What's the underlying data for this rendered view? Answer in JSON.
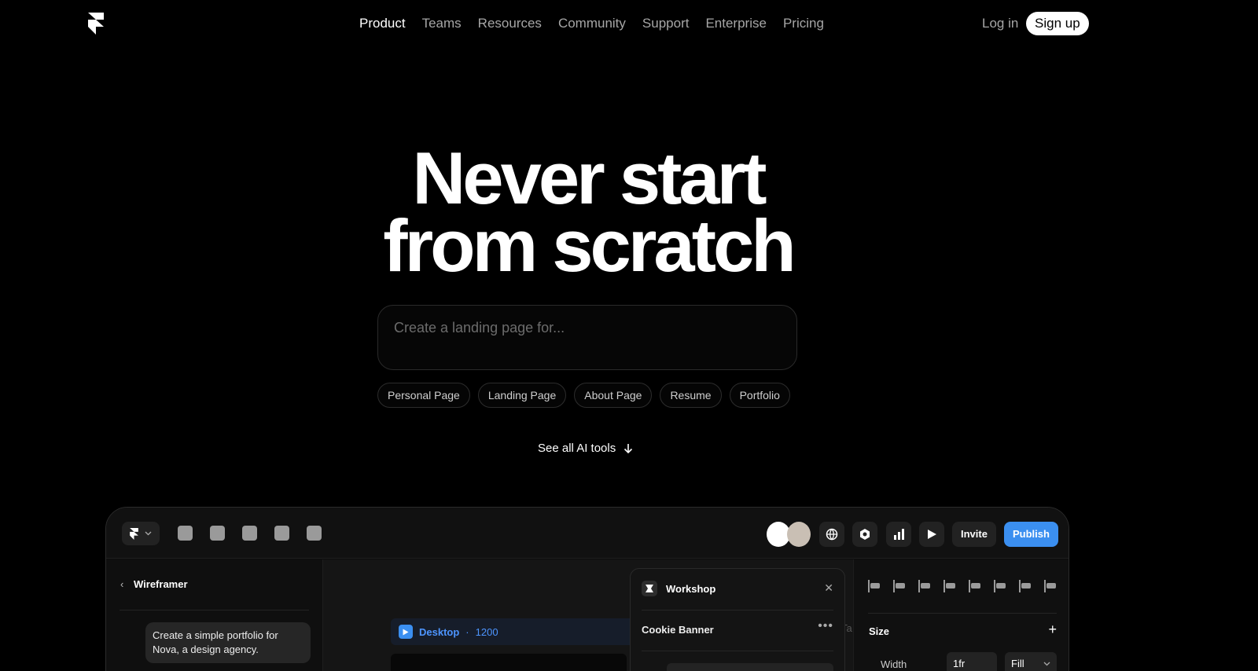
{
  "nav": {
    "links": [
      "Product",
      "Teams",
      "Resources",
      "Community",
      "Support",
      "Enterprise",
      "Pricing"
    ],
    "active": "Product",
    "login": "Log in",
    "signup": "Sign up"
  },
  "hero": {
    "title_line1": "Never start",
    "title_line2": "from scratch",
    "prompt_placeholder": "Create a landing page for...",
    "chips": [
      "Personal Page",
      "Landing Page",
      "About Page",
      "Resume",
      "Portfolio"
    ],
    "see_all": "See all AI tools"
  },
  "app": {
    "toolbar": {
      "tools": [
        "insert-icon",
        "layout-icon",
        "text-icon",
        "vector-icon",
        "cms-icon"
      ],
      "invite": "Invite",
      "publish": "Publish",
      "right_icons": [
        "globe-icon",
        "settings-icon",
        "analytics-icon",
        "preview-icon"
      ]
    },
    "left_panel": {
      "title": "Wireframer",
      "message": "Create a simple portfolio for Nova, a design agency."
    },
    "canvas": {
      "breakpoint": "Desktop",
      "separator": "·",
      "width": "1200",
      "partial_text": "Ta"
    },
    "workshop": {
      "title": "Workshop",
      "item": "Cookie Banner"
    },
    "right_panel": {
      "size_label": "Size",
      "width_label": "Width",
      "width_value": "1fr",
      "fill_value": "Fill"
    },
    "accent": "#3b8ff0"
  }
}
